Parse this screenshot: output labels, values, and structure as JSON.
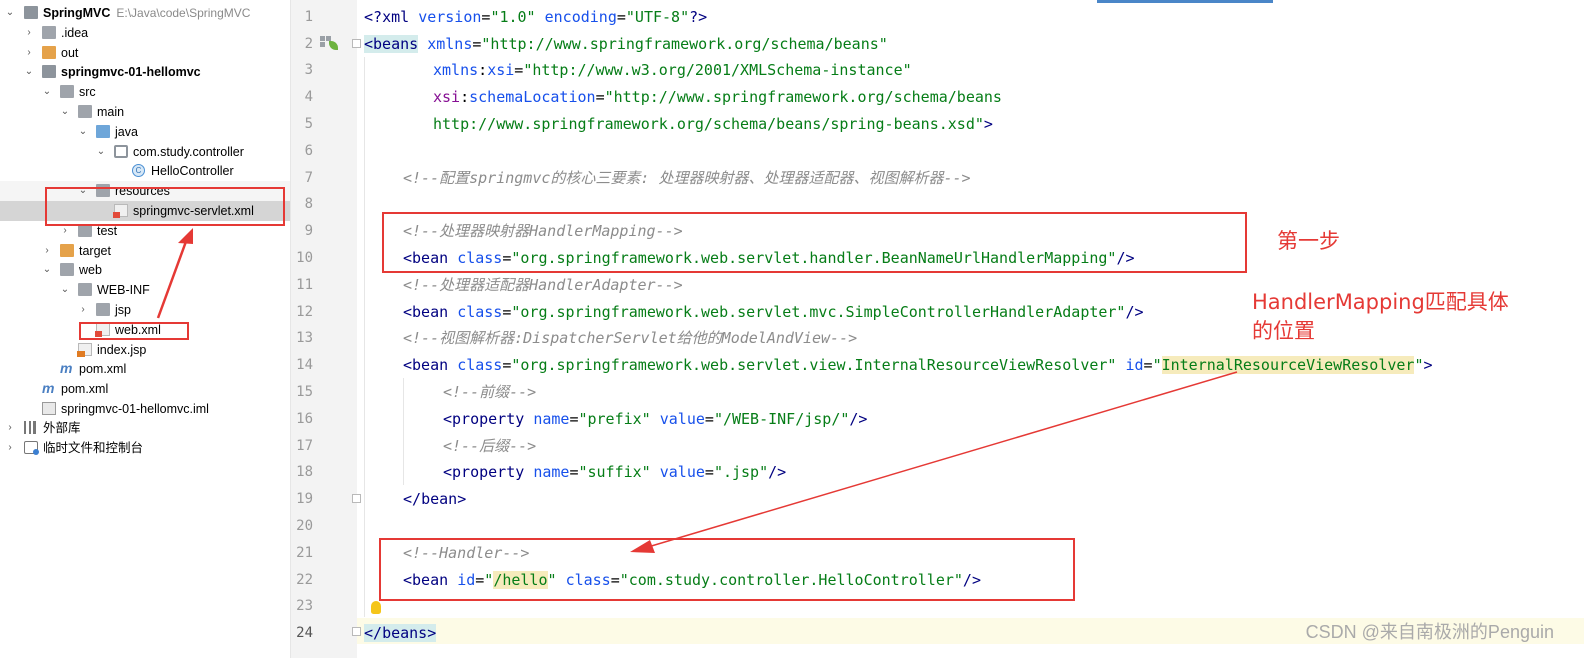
{
  "tree": {
    "items": [
      {
        "label": "SpringMVC",
        "path": "E:\\Java\\code\\SpringMVC",
        "icon": "project-folder-icon"
      },
      {
        "label": ".idea",
        "icon": "folder-icon"
      },
      {
        "label": "out",
        "icon": "folder-icon"
      },
      {
        "label": "springmvc-01-hellomvc",
        "icon": "module-folder-icon"
      },
      {
        "label": "src",
        "icon": "folder-icon"
      },
      {
        "label": "main",
        "icon": "folder-icon"
      },
      {
        "label": "java",
        "icon": "source-folder-icon"
      },
      {
        "label": "com.study.controller",
        "icon": "package-icon"
      },
      {
        "label": "HelloController",
        "icon": "class-icon"
      },
      {
        "label": "resources",
        "icon": "resources-folder-icon"
      },
      {
        "label": "springmvc-servlet.xml",
        "icon": "spring-xml-file-icon"
      },
      {
        "label": "test",
        "icon": "folder-icon"
      },
      {
        "label": "target",
        "icon": "folder-icon"
      },
      {
        "label": "web",
        "icon": "web-folder-icon"
      },
      {
        "label": "WEB-INF",
        "icon": "folder-icon"
      },
      {
        "label": "jsp",
        "icon": "folder-icon"
      },
      {
        "label": "web.xml",
        "icon": "xml-file-icon"
      },
      {
        "label": "index.jsp",
        "icon": "jsp-file-icon"
      },
      {
        "label": "pom.xml",
        "icon": "maven-icon"
      },
      {
        "label": "pom.xml",
        "icon": "maven-icon"
      },
      {
        "label": "springmvc-01-hellomvc.iml",
        "icon": "iml-file-icon"
      },
      {
        "label": "外部库",
        "icon": "library-icon"
      },
      {
        "label": "临时文件和控制台",
        "icon": "scratch-icon"
      }
    ]
  },
  "editor": {
    "line_numbers": [
      "1",
      "2",
      "3",
      "4",
      "5",
      "6",
      "7",
      "8",
      "9",
      "10",
      "11",
      "12",
      "13",
      "14",
      "15",
      "16",
      "17",
      "18",
      "19",
      "20",
      "21",
      "22",
      "23",
      "24"
    ],
    "lines": {
      "l1": {
        "a": "<?",
        "b": "xml ",
        "c": "version",
        "d": "=",
        "e": "\"1.0\"",
        "f": " ",
        "g": "encoding",
        "h": "=",
        "i": "\"UTF-8\"",
        "j": "?>"
      },
      "l2": {
        "a": "<",
        "b": "beans",
        "c": " ",
        "d": "xmlns",
        "e": "=",
        "f": "\"http://www.springframework.org/schema/beans\""
      },
      "l3": {
        "a": "xmlns",
        "b": ":",
        "c": "xsi",
        "d": "=",
        "e": "\"http://www.w3.org/2001/XMLSchema-instance\""
      },
      "l4": {
        "a": "xsi",
        "b": ":",
        "c": "schemaLocation",
        "d": "=",
        "e": "\"http://www.springframework.org/schema/beans"
      },
      "l5": {
        "a": "http://www.springframework.org/schema/beans/spring-beans.xsd\"",
        "b": ">"
      },
      "l7": "<!--配置springmvc的核心三要素: 处理器映射器、处理器适配器、视图解析器-->",
      "l9": "<!--处理器映射器HandlerMapping-->",
      "l10": {
        "a": "<",
        "b": "bean",
        "c": " ",
        "d": "class",
        "e": "=",
        "f": "\"org.springframework.web.servlet.handler.BeanNameUrlHandlerMapping\"",
        "g": "/>"
      },
      "l11": "<!--处理器适配器HandlerAdapter-->",
      "l12": {
        "a": "<",
        "b": "bean",
        "c": " ",
        "d": "class",
        "e": "=",
        "f": "\"org.springframework.web.servlet.mvc.SimpleControllerHandlerAdapter\"",
        "g": "/>"
      },
      "l13": "<!--视图解析器:DispatcherServlet给他的ModelAndView-->",
      "l14": {
        "a": "<",
        "b": "bean",
        "c": " ",
        "d": "class",
        "e": "=",
        "f": "\"org.springframework.web.servlet.view.InternalResourceViewResolver\"",
        "g": " ",
        "h": "id",
        "i": "=",
        "j": "\"",
        "k": "InternalResourceViewResolver",
        "l": "\"",
        "m": ">"
      },
      "l15": "<!--前缀-->",
      "l16": {
        "a": "<",
        "b": "property",
        "c": " ",
        "d": "name",
        "e": "=",
        "f": "\"prefix\"",
        "g": " ",
        "h": "value",
        "i": "=",
        "j": "\"/WEB-INF/jsp/\"",
        "k": "/>"
      },
      "l17": "<!--后缀-->",
      "l18": {
        "a": "<",
        "b": "property",
        "c": " ",
        "d": "name",
        "e": "=",
        "f": "\"suffix\"",
        "g": " ",
        "h": "value",
        "i": "=",
        "j": "\".jsp\"",
        "k": "/>"
      },
      "l19": {
        "a": "</",
        "b": "bean",
        "c": ">"
      },
      "l21": "<!--Handler-->",
      "l22": {
        "a": "<",
        "b": "bean",
        "c": " ",
        "d": "id",
        "e": "=",
        "f": "\"",
        "g": "/hello",
        "h": "\"",
        "i": " ",
        "j": "class",
        "k": "=",
        "l": "\"com.study.controller.HelloController\"",
        "m": "/>"
      },
      "l24": {
        "a": "</",
        "b": "beans",
        "c": ">"
      }
    }
  },
  "annotations": {
    "step1": "第一步",
    "mapping_note_line1": "HandlerMapping匹配具体",
    "mapping_note_line2": "的位置",
    "color": "#e53935"
  },
  "watermark": "CSDN @来自南极洲的Penguin"
}
